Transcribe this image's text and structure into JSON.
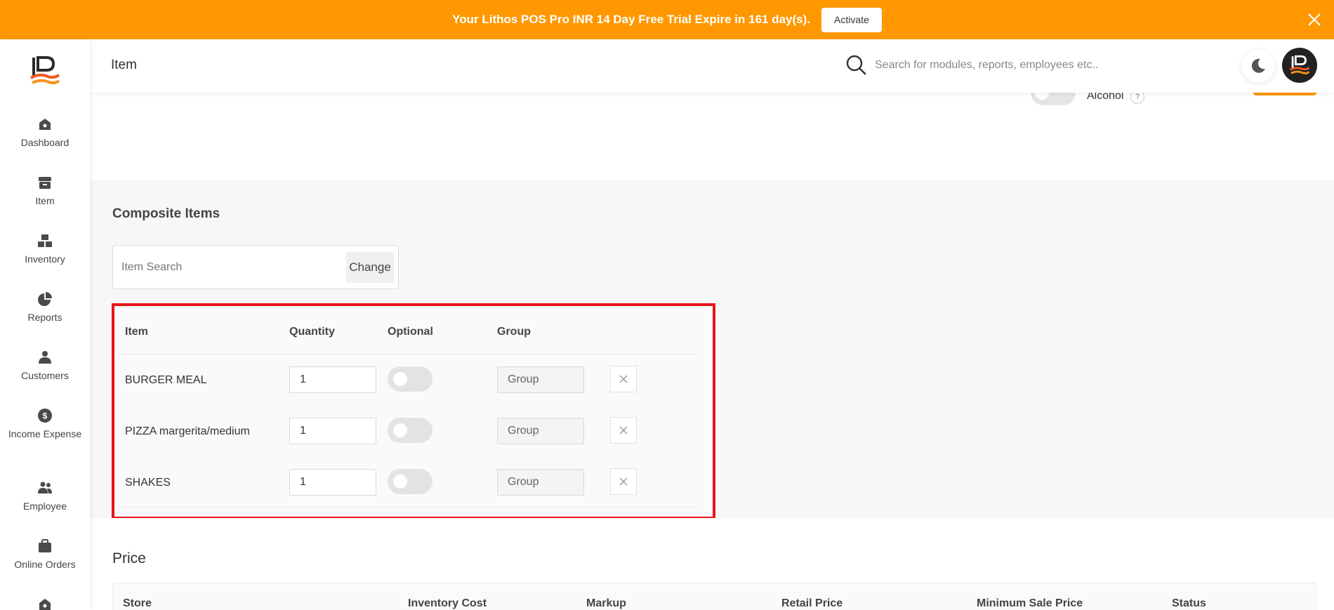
{
  "banner": {
    "message": "Your Lithos POS Pro INR 14 Day Free Trial Expire in 161 day(s).",
    "activate_label": "Activate"
  },
  "sidebar": {
    "items": [
      {
        "label": "Dashboard",
        "icon": "dashboard-icon"
      },
      {
        "label": "Item",
        "icon": "item-icon"
      },
      {
        "label": "Inventory",
        "icon": "inventory-icon"
      },
      {
        "label": "Reports",
        "icon": "reports-icon"
      },
      {
        "label": "Customers",
        "icon": "customers-icon"
      },
      {
        "label": "Income Expense",
        "icon": "income-expense-icon"
      },
      {
        "label": "Employee",
        "icon": "employee-icon"
      },
      {
        "label": "Online Orders",
        "icon": "online-orders-icon"
      }
    ]
  },
  "header": {
    "title": "Item",
    "search_placeholder": "Search for modules, reports, employees etc.."
  },
  "prev_card": {
    "alcohol_label": "Alcohol",
    "help_glyph": "?"
  },
  "composite": {
    "title": "Composite Items",
    "search_placeholder": "Item Search",
    "change_label": "Change",
    "columns": [
      "Item",
      "Quantity",
      "Optional",
      "Group"
    ],
    "rows": [
      {
        "name": "BURGER MEAL",
        "quantity": "1",
        "optional": false,
        "group_placeholder": "Group"
      },
      {
        "name": "PIZZA margerita/medium",
        "quantity": "1",
        "optional": false,
        "group_placeholder": "Group"
      },
      {
        "name": "SHAKES",
        "quantity": "1",
        "optional": false,
        "group_placeholder": "Group"
      }
    ]
  },
  "price": {
    "title": "Price",
    "columns": [
      "Store",
      "Inventory Cost",
      "Markup",
      "Retail Price",
      "Minimum Sale Price",
      "Status"
    ]
  },
  "colors": {
    "accent": "#ff9800",
    "highlight": "#e8151b"
  }
}
